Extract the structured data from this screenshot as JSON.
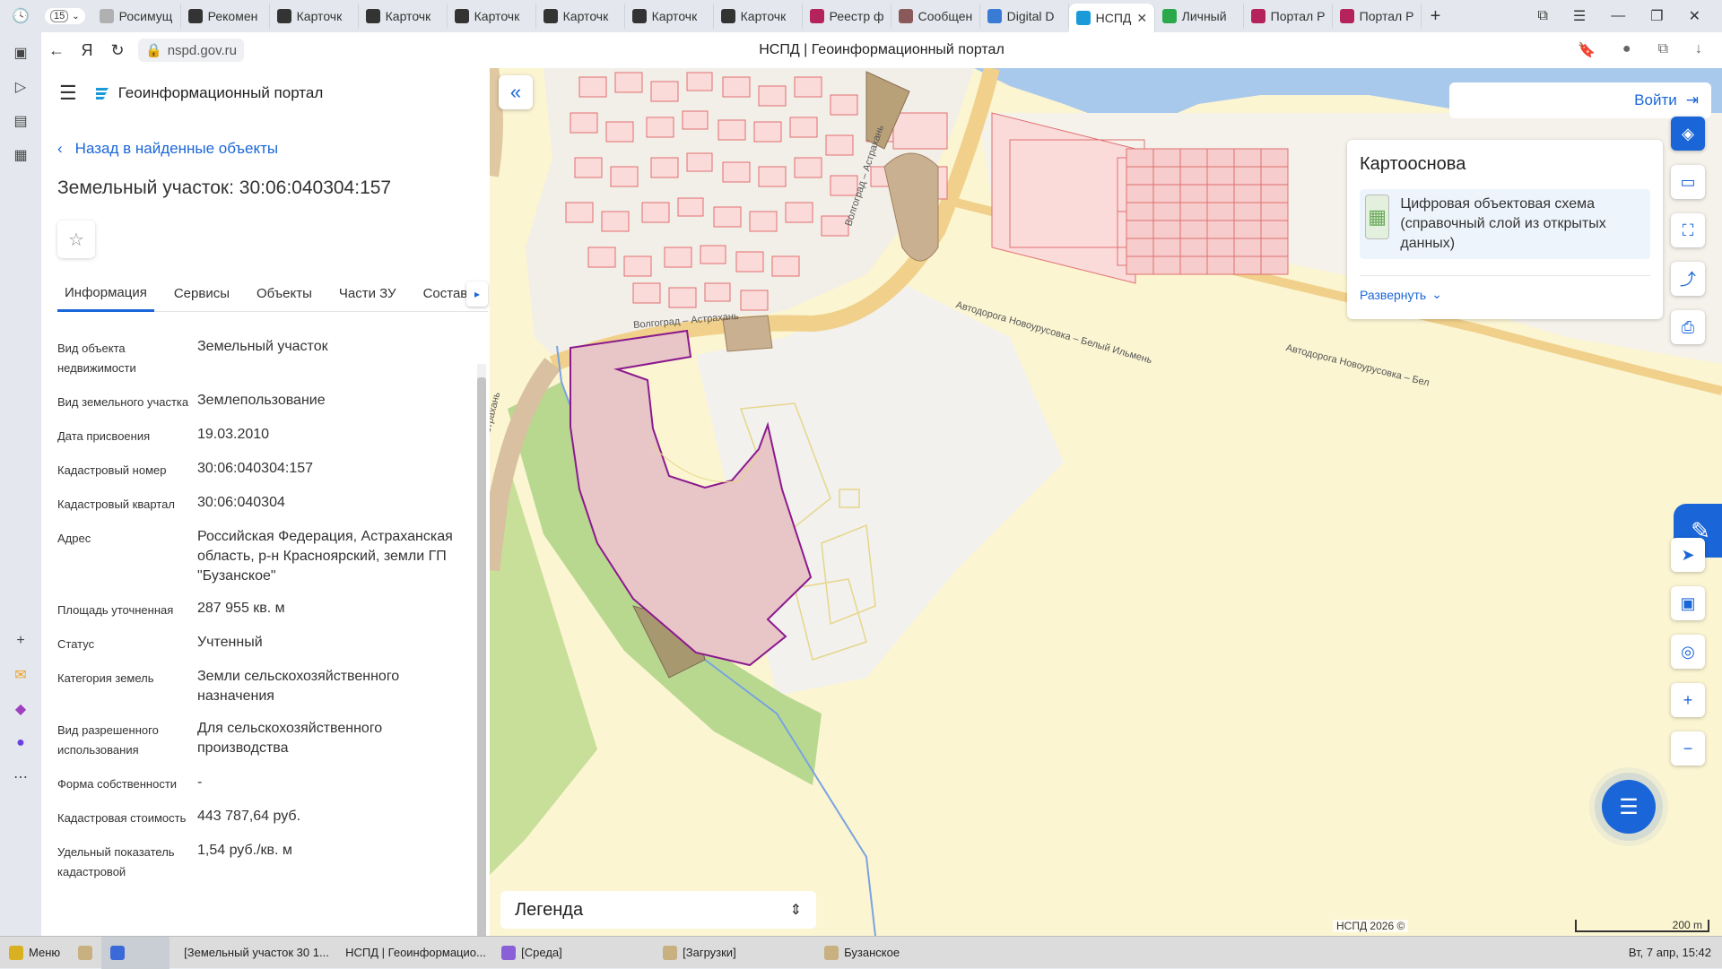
{
  "browser": {
    "tab_count": "15",
    "tabs": [
      {
        "label": "Росимущ",
        "icon": "orb-icon",
        "color": "#b0b0b0"
      },
      {
        "label": "Рекомен",
        "icon": "a-icon",
        "color": "#333"
      },
      {
        "label": "Карточк",
        "icon": "a-icon",
        "color": "#333"
      },
      {
        "label": "Карточк",
        "icon": "a-icon",
        "color": "#333"
      },
      {
        "label": "Карточк",
        "icon": "a-icon",
        "color": "#333"
      },
      {
        "label": "Карточк",
        "icon": "a-icon",
        "color": "#333"
      },
      {
        "label": "Карточк",
        "icon": "a-icon",
        "color": "#333"
      },
      {
        "label": "Карточк",
        "icon": "a-icon",
        "color": "#333"
      },
      {
        "label": "Реестр ф",
        "icon": "flag-icon",
        "color": "#b4245a"
      },
      {
        "label": "Сообщен",
        "icon": "orb-icon",
        "color": "#8a5a5a"
      },
      {
        "label": "Digital D",
        "icon": "doc-icon",
        "color": "#3a7bd5"
      },
      {
        "label": "НСПД",
        "icon": "nspd-icon",
        "color": "#1a9ad8",
        "active": true
      },
      {
        "label": "Личный",
        "icon": "shield-icon",
        "color": "#2aa84a"
      },
      {
        "label": "Портал Р",
        "icon": "flag-icon",
        "color": "#b4245a"
      },
      {
        "label": "Портал Р",
        "icon": "flag-icon",
        "color": "#b4245a"
      }
    ],
    "url": "nspd.gov.ru",
    "page_title": "НСПД | Геоинформационный портал"
  },
  "panel": {
    "portal_title": "Геоинформационный портал",
    "back_label": "Назад в найденные объекты",
    "object_title": "Земельный участок: 30:06:040304:157",
    "tabs": [
      "Информация",
      "Сервисы",
      "Объекты",
      "Части ЗУ",
      "Состав"
    ],
    "fields": [
      {
        "label": "Вид объекта недвижимости",
        "value": "Земельный участок"
      },
      {
        "label": "Вид земельного участка",
        "value": "Землепользование"
      },
      {
        "label": "Дата присвоения",
        "value": "19.03.2010"
      },
      {
        "label": "Кадастровый номер",
        "value": "30:06:040304:157"
      },
      {
        "label": "Кадастровый квартал",
        "value": "30:06:040304"
      },
      {
        "label": "Адрес",
        "value": "Российская Федерация, Астраханская область, р-н Красноярский, земли ГП \"Бузанское\""
      },
      {
        "label": "Площадь уточненная",
        "value": "287 955 кв. м"
      },
      {
        "label": "Статус",
        "value": "Учтенный"
      },
      {
        "label": "Категория земель",
        "value": "Земли сельскохозяйственного назначения"
      },
      {
        "label": "Вид разрешенного использования",
        "value": "Для сельскохозяйственного производства"
      },
      {
        "label": "Форма собственности",
        "value": "-"
      },
      {
        "label": "Кадастровая стоимость",
        "value": "443 787,64 руб."
      },
      {
        "label": "Удельный показатель кадастровой",
        "value": "1,54 руб./кв. м"
      }
    ]
  },
  "map": {
    "login_label": "Войти",
    "basemap_title": "Картооснова",
    "basemap_item": "Цифровая объектовая схема (справочный слой из открытых данных)",
    "expand_label": "Развернуть",
    "legend_label": "Легенда",
    "copyright": "НСПД 2026 ©",
    "scale": "200 m",
    "road_labels": [
      "Волгоград – Астрахань",
      "Волгоград – Астрахань",
      "Автодорога Новоурусовка – Белый Ильмень",
      "Автодорога Новоурусовка – Бел",
      "Волгоград – Астрахань"
    ],
    "colors": {
      "accent": "#1a66d8",
      "parcel_fill": "#e8c6c8",
      "parcel_border": "#8b1a8e",
      "water": "#a8c8ec",
      "land": "#fbf5d2"
    }
  },
  "taskbar": {
    "menu_label": "Меню",
    "windows": [
      "[Земельный участок 30 1...",
      "НСПД | Геоинформацио...",
      "[Среда]",
      "[Загрузки]",
      "Бузанское"
    ],
    "clock": "Вт, 7 апр, 15:42"
  }
}
